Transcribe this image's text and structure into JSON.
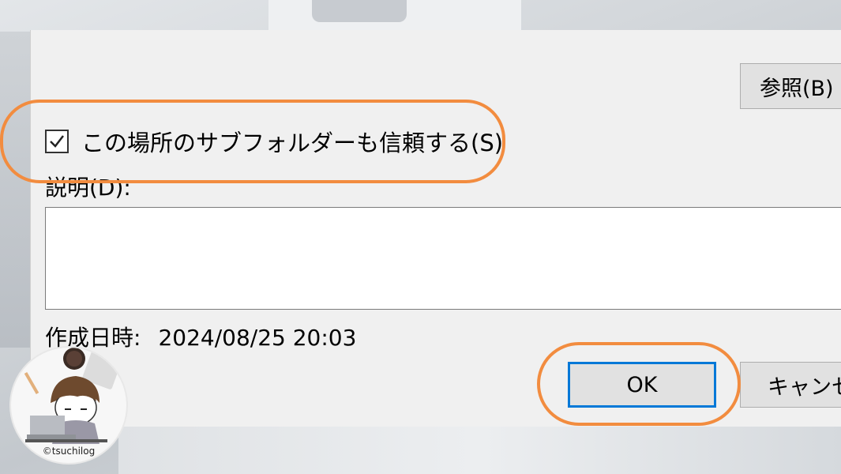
{
  "dialog": {
    "browse_label": "参照(B)",
    "subfolder_checkbox": {
      "label": "この場所のサブフォルダーも信頼する(S)",
      "checked": true
    },
    "description_label": "説明(D):",
    "description_value": "",
    "created_label": "作成日時:",
    "created_value": "2024/08/25 20:03",
    "ok_label": "OK",
    "cancel_label": "キャンセ"
  },
  "highlight_color": "#f28c3f",
  "focus_color": "#0078d7",
  "logo": {
    "text": "©tsuchilog"
  }
}
